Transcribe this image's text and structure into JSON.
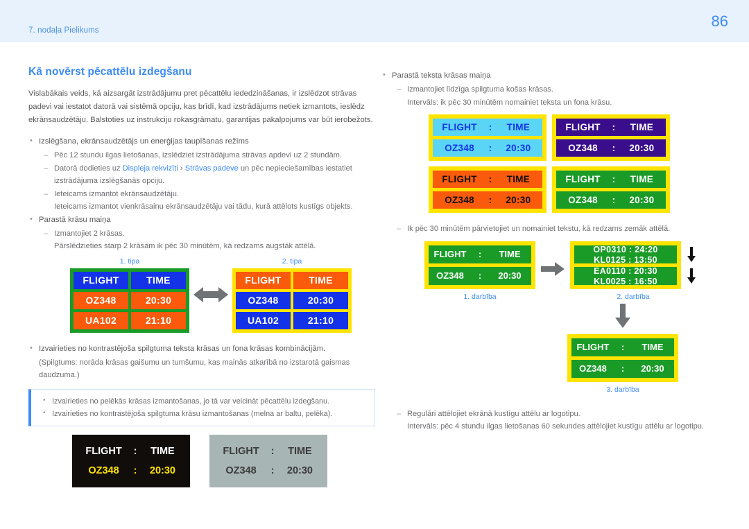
{
  "header": {
    "chapter": "7. nodaļa Pielikums",
    "page_number": "86",
    "band_color": "#e8f2fd",
    "accent_color": "#3d8bf2"
  },
  "left": {
    "title": "Kā novērst pēcattēlu izdegšanu",
    "intro": "Vislabākais veids, kā aizsargāt izstrādājumu pret pēcattēlu iededzināšanas, ir izslēdzot strāvas padevi vai iestatot datorā vai sistēmā opciju, kas brīdī, kad izstrādājums netiek izmantots, ieslēdz ekrānsaudzētāju. Balstoties uz instrukciju rokasgrāmatu, garantijas pakalpojums var būt ierobežots.",
    "bullet1": "Izslēgšana, ekrānsaudzētājs un enerģijas taupīšanas režīms",
    "sub1": "Pēc 12 stundu ilgas lietošanas, izslēdziet izstrādājuma strāvas apdevi uz 2 stundām.",
    "sub2_pre": "Datorā dodieties uz ",
    "sub2_link1": "Displeja rekvizīti",
    "sub2_sep": " › ",
    "sub2_link2": "Strāvas padeve",
    "sub2_post": " un pēc nepieciešamības iestatiet",
    "sub2_cont": "izstrādājuma izslēgšanās opciju.",
    "sub3": "Ieteicams izmantot ekrānsaudzētāju.",
    "sub3_cont": "Ieteicams izmantot vienkrāsainu ekrānsaudzētāju vai tādu, kurā attēlots kustīgs objekts.",
    "bullet2": "Parastā krāsu maiņa",
    "sub4": "Izmantojiet 2 krāsas.",
    "sub4_cont": "Pārslēdzieties starp 2 krāsām ik pēc 30 minūtēm, kā redzams augstāk attēlā.",
    "bullet3": "Izvairieties no kontrastējoša spilgtuma teksta krāsas un fona krāsas kombinācijām.",
    "bullet3_cont1": "(Spilgtums: norāda krāsas gaišumu un tumšumu, kas mainās atkarībā no izstarotā gaismas",
    "bullet3_cont2": "daudzuma.)",
    "note": {
      "items": [
        "Izvairieties no pelēkās krāsas izmantošanas, jo tā var veicināt pēcattēlu izdegšanu.",
        "Izvairieties no kontrastējoša spilgtuma krāsu izmantošanas (melna ar baltu, pelēka)."
      ]
    },
    "type_boards": {
      "caption1": "1. tipa",
      "caption2": "2. tipa",
      "headers": [
        "FLIGHT",
        "TIME"
      ],
      "rows": [
        [
          "OZ348",
          "20:30"
        ],
        [
          "UA102",
          "21:10"
        ]
      ],
      "type1": {
        "border": "#1a9b28",
        "header_bg": "#1433e8",
        "cell_bg": "#f95a0c",
        "text": "#ffffff"
      },
      "type2": {
        "border": "#ffe400",
        "header_bg": "#f95a0c",
        "cell_bg": "#1433e8",
        "text": "#ffffff"
      },
      "arrow": "double-arrow-icon"
    },
    "contrast_boards": [
      {
        "bg": "#110d0b",
        "header_text": "#ffffff",
        "row_text": "#ffe400",
        "header": [
          "FLIGHT",
          ":",
          "TIME"
        ],
        "row": [
          "OZ348",
          ":",
          "20:30"
        ]
      },
      {
        "bg": "#a8b5b5",
        "header_text": "#3a3a3a",
        "row_text": "#3a3a3a",
        "header": [
          "FLIGHT",
          ":",
          "TIME"
        ],
        "row": [
          "OZ348",
          ":",
          "20:30"
        ]
      }
    ]
  },
  "right": {
    "bullet1": "Parastā teksta krāsas maiņa",
    "sub1": "Izmantojiet līdzīga spilgtuma košas krāsas.",
    "sub1_cont": "Intervāls: ik pēc 30 minūtēm nomainiet teksta un fona krāsu.",
    "sub2": "Ik pēc 30 minūtēm pārvietojiet un nomainiet tekstu, kā redzams zemāk attēlā.",
    "sub3": "Regulāri attēlojiet ekrānā kustīgu attēlu ar logotipu.",
    "sub3_cont": "Intervāls: pēc 4 stundu ilgas lietošanas 60 sekundes attēlojiet kustīgu attēlu ar logotipu.",
    "color_boards": {
      "frame": "#ffe400",
      "header": [
        "FLIGHT",
        ":",
        "TIME"
      ],
      "row": [
        "OZ348",
        ":",
        "20:30"
      ],
      "variants": [
        {
          "name": "cyan",
          "bg": "#5ad5f5",
          "text": "#1433e8"
        },
        {
          "name": "purple",
          "bg": "#3a0d8c",
          "text": "#ffffff"
        },
        {
          "name": "orange",
          "bg": "#f95a0c",
          "text": "#110d0b"
        },
        {
          "name": "green",
          "bg": "#1a9b28",
          "text": "#ffffff"
        }
      ]
    },
    "steps": {
      "frame": "#ffe400",
      "board_bg": "#1a9b28",
      "board_text": "#ffffff",
      "step1": {
        "caption": "1. darbība",
        "header": [
          "FLIGHT",
          ":",
          "TIME"
        ],
        "row": [
          "OZ348",
          ":",
          "20:30"
        ]
      },
      "step2": {
        "caption": "2. darbība",
        "row1_top": "OP0310 : 24:20",
        "row1_bottom": "KL0125 : 13:50",
        "row2_top": "EA0110 : 20:30",
        "row2_bottom": "KL0025 : 16:50",
        "arrow_down_1": "arrow-down-icon",
        "arrow_down_2": "arrow-down-icon"
      },
      "step3": {
        "caption": "3. darbība",
        "header": [
          "FLIGHT",
          ":",
          "TIME"
        ],
        "row": [
          "OZ348",
          ":",
          "20:30"
        ]
      },
      "arrow_right": "arrow-right-icon",
      "arrow_down": "arrow-down-thick-icon"
    }
  }
}
